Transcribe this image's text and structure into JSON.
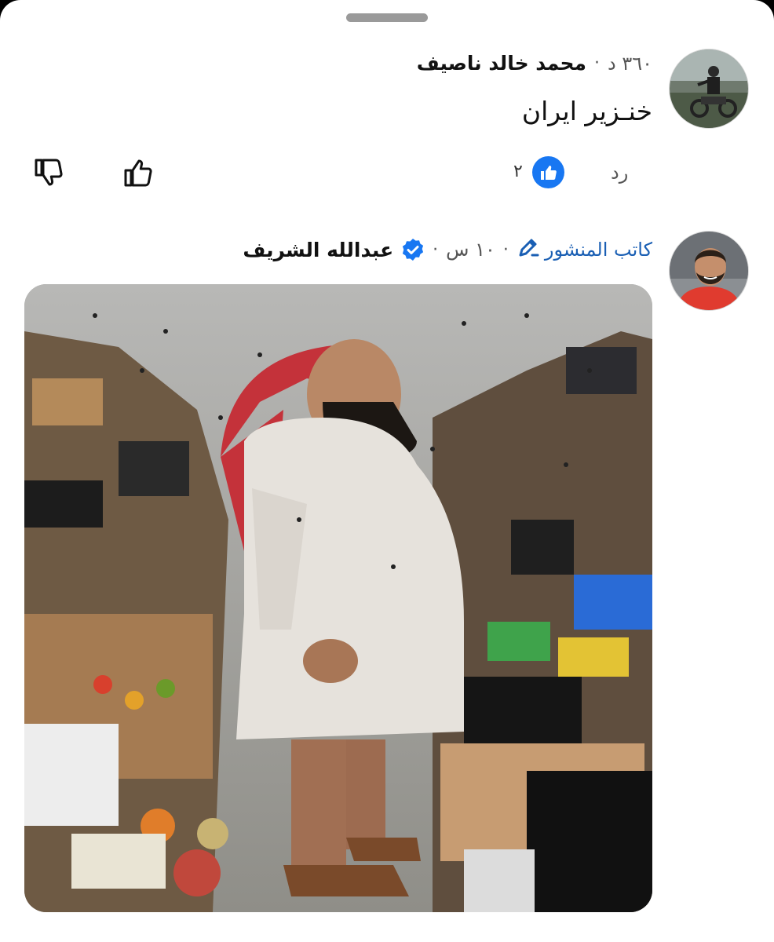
{
  "comments": [
    {
      "author": "محمد خالد ناصيف",
      "time": "٣٦٠ د",
      "text": "خنـزير ايران",
      "reply_label": "رد",
      "like_count": "٢"
    },
    {
      "author": "عبدالله الشريف",
      "verified": true,
      "time": "١٠ س",
      "author_tag": "كاتب المنشور",
      "attachment": "image"
    }
  ],
  "colors": {
    "like_blue": "#1877f2",
    "author_tag_blue": "#1a5fb4",
    "verified_blue": "#1877f2"
  },
  "icons": [
    "dislike-icon",
    "like-icon",
    "like-reaction-icon",
    "verified-icon",
    "pencil-icon"
  ]
}
